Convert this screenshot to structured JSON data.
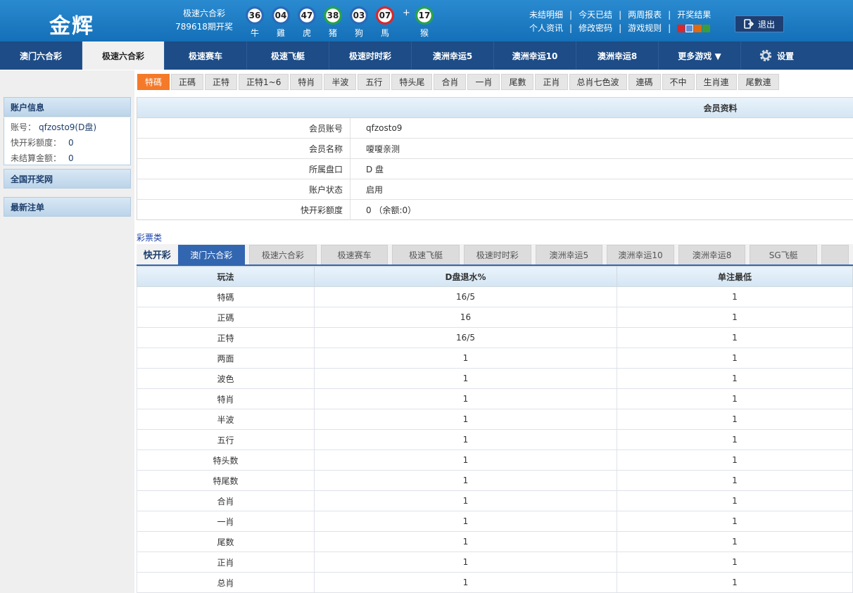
{
  "header": {
    "logo": "金辉",
    "draw_game": "极速六合彩",
    "draw_issue": "789618期开奖",
    "balls": [
      {
        "num": "36",
        "zodiac": "牛",
        "color": "blue"
      },
      {
        "num": "04",
        "zodiac": "雞",
        "color": "blue"
      },
      {
        "num": "47",
        "zodiac": "虎",
        "color": "blue"
      },
      {
        "num": "38",
        "zodiac": "猪",
        "color": "green"
      },
      {
        "num": "03",
        "zodiac": "狗",
        "color": "blue"
      },
      {
        "num": "07",
        "zodiac": "馬",
        "color": "red"
      },
      {
        "num": "17",
        "zodiac": "猴",
        "color": "green"
      }
    ],
    "plus": "+",
    "links_row1": [
      "未结明细",
      "今天已结",
      "两周报表",
      "开奖结果"
    ],
    "links_row2": [
      "个人资讯",
      "修改密码",
      "游戏规则"
    ],
    "sep": "|",
    "theme_colors": [
      "#d8282c",
      "#5b8fd8",
      "#e06a10",
      "#3b9c3b"
    ],
    "logout": "退出"
  },
  "nav": {
    "items": [
      "澳门六合彩",
      "极速六合彩",
      "极速赛车",
      "极速飞艇",
      "极速时时彩",
      "澳洲幸运5",
      "澳洲幸运10",
      "澳洲幸运8",
      "更多游戏 ▼"
    ],
    "settings": "设置"
  },
  "subtabs": [
    "特碼",
    "正碼",
    "正特",
    "正特1~6",
    "特肖",
    "半波",
    "五行",
    "特头尾",
    "合肖",
    "一肖",
    "尾數",
    "正肖",
    "总肖七色波",
    "連碼",
    "不中",
    "生肖連",
    "尾數連"
  ],
  "sidebar": {
    "account_title": "账户信息",
    "account_label": "账号：",
    "account_value": "qfzosto9(D盘)",
    "quota_label": "快开彩额度：",
    "quota_value": "0",
    "unsettled_label": "未结算金额：",
    "unsettled_value": "0",
    "draw_net": "全国开奖网",
    "latest_bets": "最新注单"
  },
  "member": {
    "title": "会员资料",
    "rows": [
      {
        "label": "会员账号",
        "value": "qfzosto9"
      },
      {
        "label": "会员名称",
        "value": "嗄嗄亲测"
      },
      {
        "label": "所属盘口",
        "value": "D 盘"
      },
      {
        "label": "账户状态",
        "value": "启用"
      },
      {
        "label": "快开彩额度",
        "value": "0 （余额:0）"
      }
    ]
  },
  "category_label": "彩票类",
  "quick_label": "快开彩",
  "game_tabs": [
    "澳门六合彩",
    "极速六合彩",
    "极速赛车",
    "极速飞艇",
    "极速时时彩",
    "澳洲幸运5",
    "澳洲幸运10",
    "澳洲幸运8",
    "SG飞艇"
  ],
  "rate_table": {
    "headers": [
      "玩法",
      "D盘退水%",
      "单注最低"
    ],
    "rows": [
      [
        "特碼",
        "16/5",
        "1"
      ],
      [
        "正碼",
        "16",
        "1"
      ],
      [
        "正特",
        "16/5",
        "1"
      ],
      [
        "两面",
        "1",
        "1"
      ],
      [
        "波色",
        "1",
        "1"
      ],
      [
        "特肖",
        "1",
        "1"
      ],
      [
        "半波",
        "1",
        "1"
      ],
      [
        "五行",
        "1",
        "1"
      ],
      [
        "特头数",
        "1",
        "1"
      ],
      [
        "特尾数",
        "1",
        "1"
      ],
      [
        "合肖",
        "1",
        "1"
      ],
      [
        "一肖",
        "1",
        "1"
      ],
      [
        "尾数",
        "1",
        "1"
      ],
      [
        "正肖",
        "1",
        "1"
      ],
      [
        "总肖",
        "1",
        "1"
      ]
    ]
  }
}
